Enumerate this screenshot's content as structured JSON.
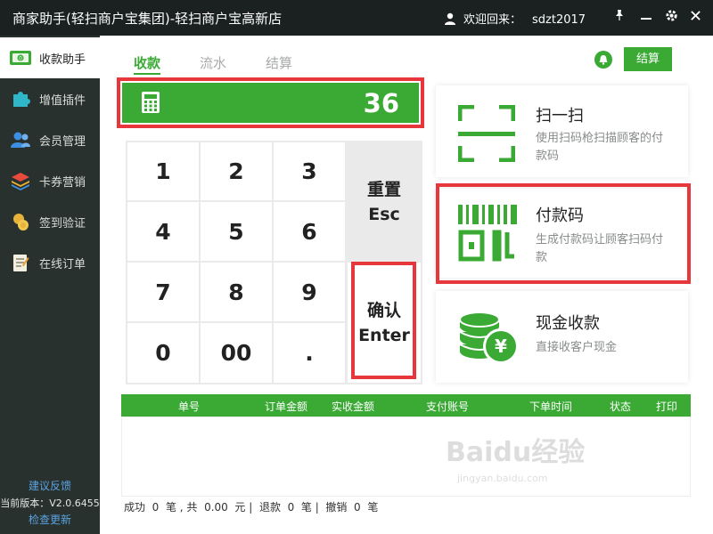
{
  "window": {
    "title": "商家助手(轻扫商户宝集团)-轻扫商户宝高新店",
    "welcome": "欢迎回来：",
    "username": "sdzt2017"
  },
  "sidebar": {
    "items": [
      {
        "label": "收款助手",
        "icon": "cash-register-icon",
        "active": true
      },
      {
        "label": "增值插件",
        "icon": "puzzle-icon"
      },
      {
        "label": "会员管理",
        "icon": "members-icon"
      },
      {
        "label": "卡券营销",
        "icon": "coupons-icon"
      },
      {
        "label": "签到验证",
        "icon": "checkin-icon"
      },
      {
        "label": "在线订单",
        "icon": "order-icon"
      }
    ],
    "feedback": "建议反馈",
    "version": "当前版本：V2.0.6455",
    "update": "检查更新"
  },
  "tabs": [
    {
      "label": "收款",
      "active": true
    },
    {
      "label": "流水"
    },
    {
      "label": "结算"
    }
  ],
  "settle_button": "结算",
  "amount": "36",
  "keypad": {
    "keys": [
      "1",
      "2",
      "3",
      "4",
      "5",
      "6",
      "7",
      "8",
      "9",
      "0",
      "00",
      "."
    ],
    "reset_line1": "重置",
    "reset_line2": "Esc",
    "confirm_line1": "确认",
    "confirm_line2": "Enter"
  },
  "cards": [
    {
      "title": "扫一扫",
      "desc": "使用扫码枪扫描顾客的付款码",
      "icon": "scan-icon"
    },
    {
      "title": "付款码",
      "desc": "生成付款码让顾客扫码付款",
      "icon": "barcode-icon"
    },
    {
      "title": "现金收款",
      "desc": "直接收客户现金",
      "icon": "coins-icon"
    }
  ],
  "table": {
    "columns": [
      "单号",
      "订单金额",
      "实收金额",
      "支付账号",
      "下单时间",
      "状态",
      "打印"
    ]
  },
  "status": {
    "success_label": "成功",
    "success_count": "0",
    "unit": "笔",
    "total_label": "共",
    "total_amount": "0.00",
    "currency": "元",
    "refund_label": "退款",
    "refund_count": "0",
    "cancel_label": "撤销",
    "cancel_count": "0"
  },
  "watermark": {
    "brand": "Baidu经验",
    "url": "jingyan.baidu.com"
  },
  "colors": {
    "accent": "#3aaa35",
    "highlight": "#e8363d",
    "sidebar": "#29312f",
    "titlebar": "#1b2121"
  }
}
